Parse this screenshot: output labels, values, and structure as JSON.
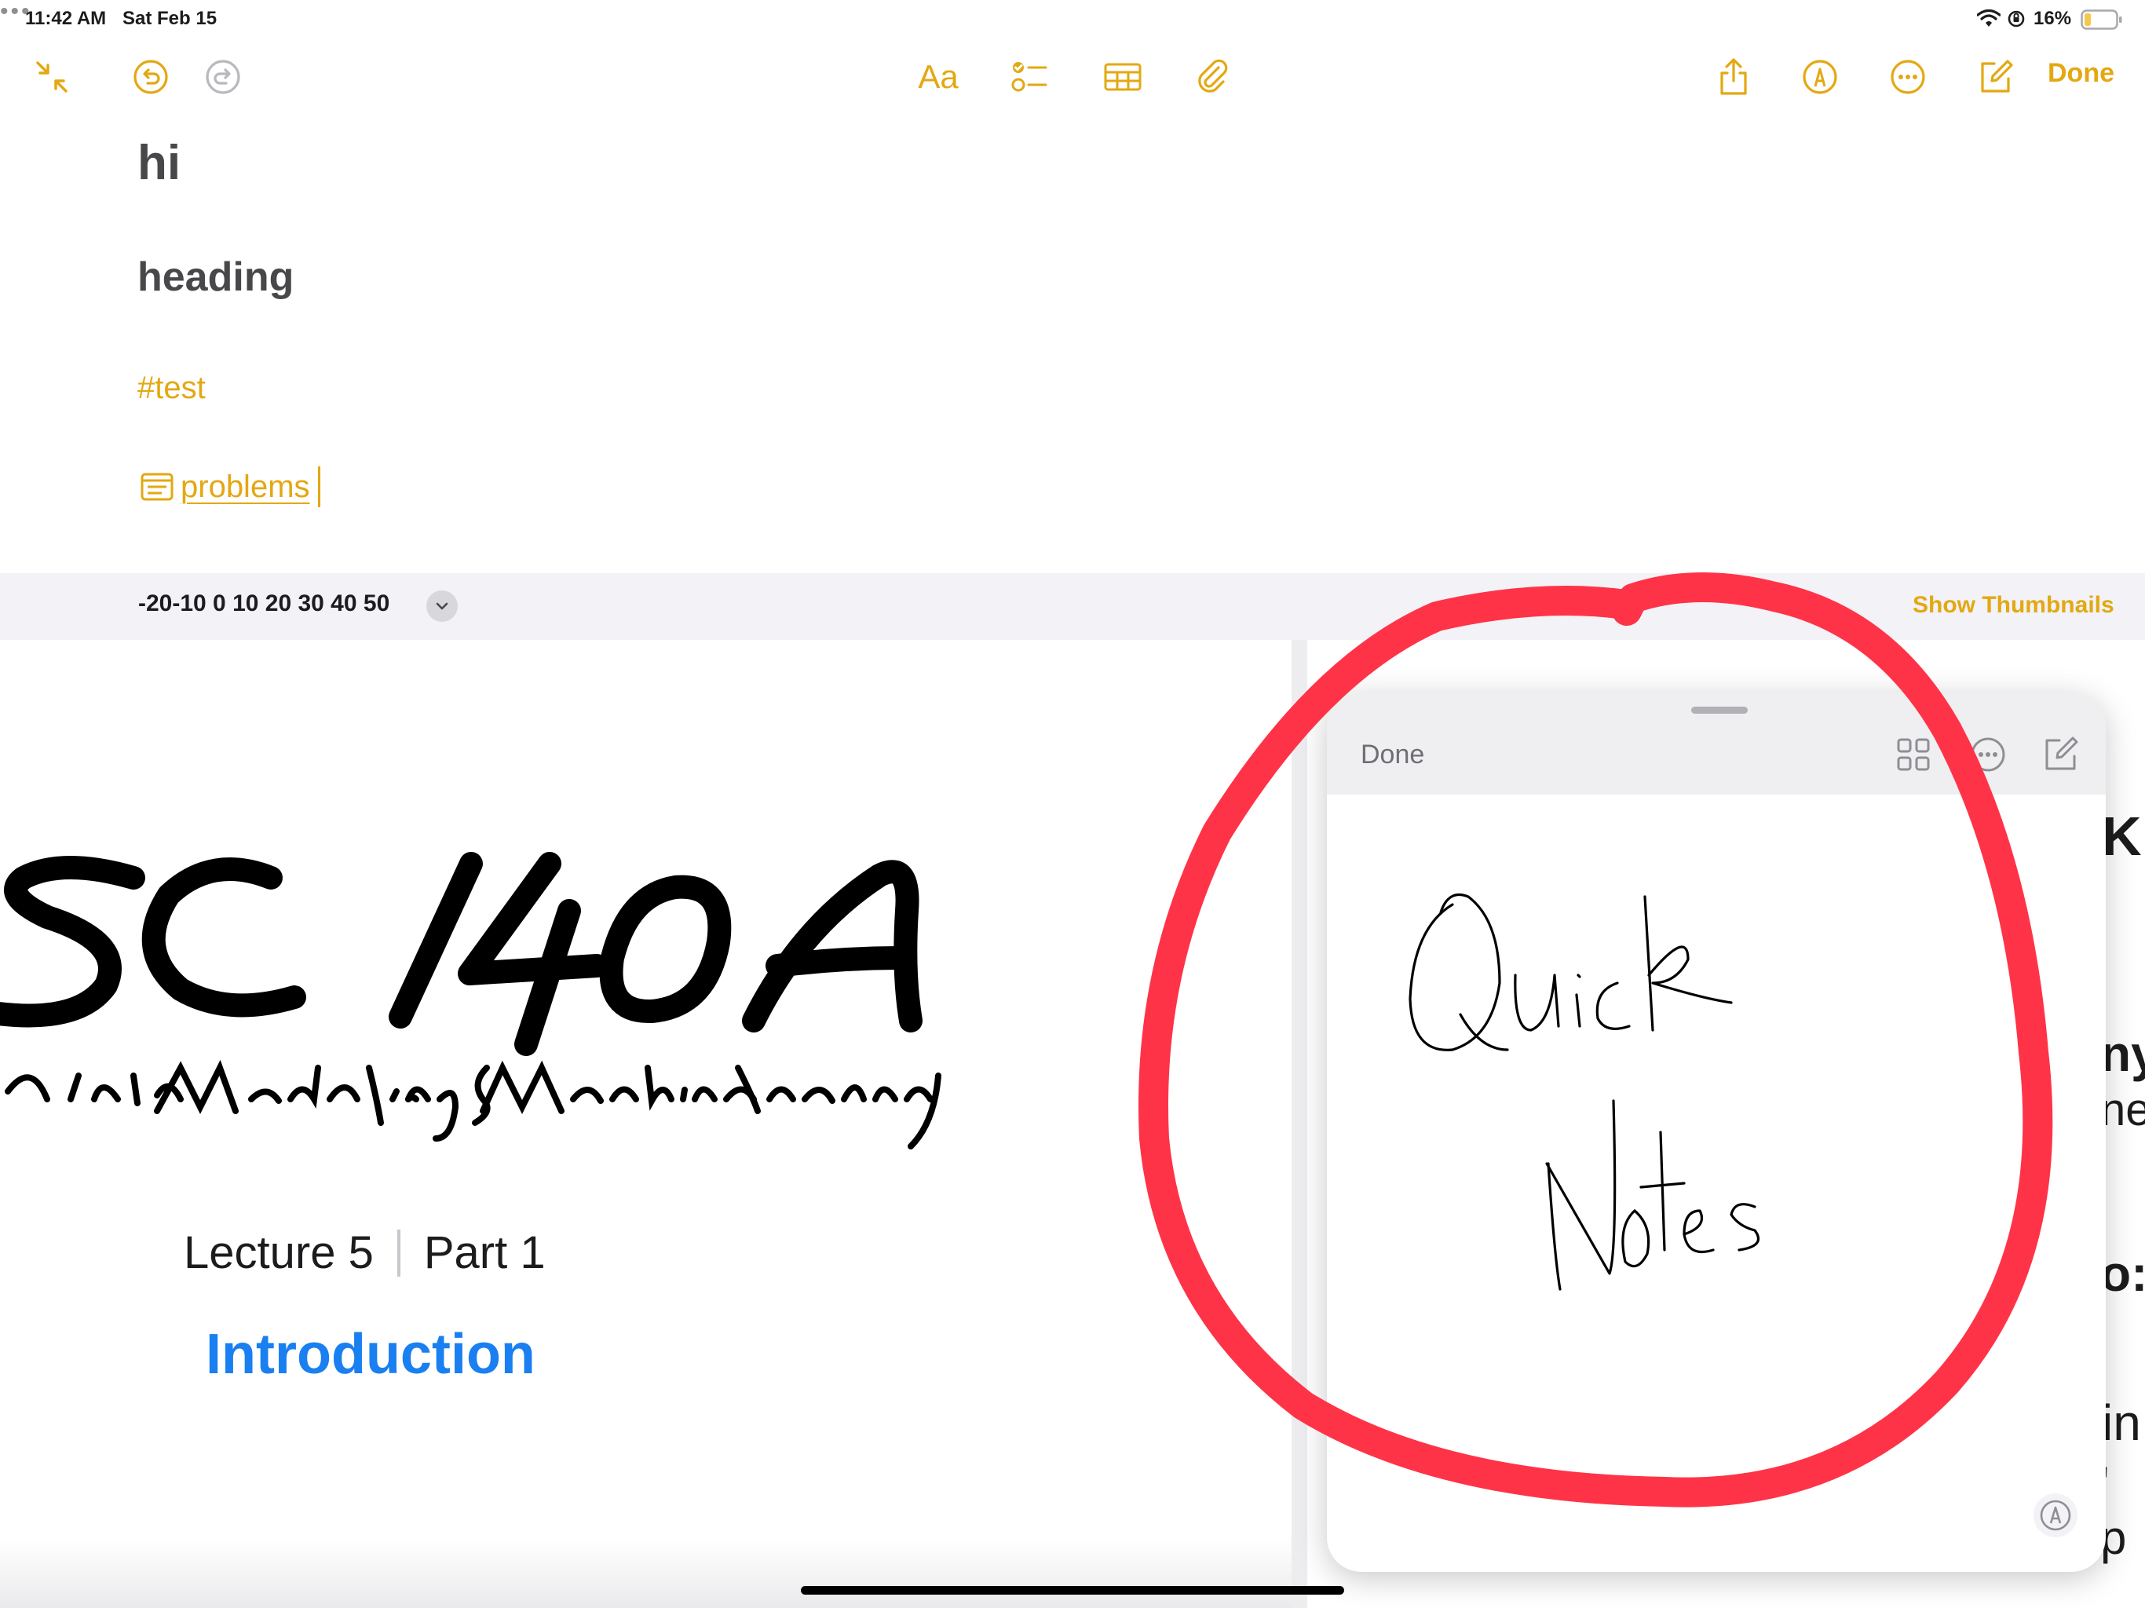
{
  "status": {
    "time": "11:42 AM",
    "date": "Sat Feb 15",
    "battery": "16%"
  },
  "toolbar": {
    "done_label": "Done",
    "icons": [
      "collapse-icon",
      "undo-icon",
      "redo-icon",
      "format-text-icon",
      "checklist-icon",
      "table-icon",
      "attachment-icon",
      "share-icon",
      "markup-icon",
      "more-icon",
      "compose-icon"
    ],
    "format_label": "Aa"
  },
  "note": {
    "title": "hi",
    "heading": "heading",
    "tag": "#test",
    "link_text": "problems"
  },
  "attachment": {
    "name": "-20-10 0 10 20 30 40 50",
    "show_thumbnails": "Show Thumbnails"
  },
  "pdf": {
    "course_code": "SC 140A",
    "subtitle": "listic Modeling & Machine Learning",
    "lecture": "Lecture 5",
    "part": "Part 1",
    "section": "Introduction"
  },
  "quick_note": {
    "done_label": "Done",
    "handwriting_line1": "Quick",
    "handwriting_line2": "Notes"
  },
  "colors": {
    "accent": "#E3A812",
    "link_blue": "#1a7ff0",
    "annotation_red": "#FF3347"
  }
}
